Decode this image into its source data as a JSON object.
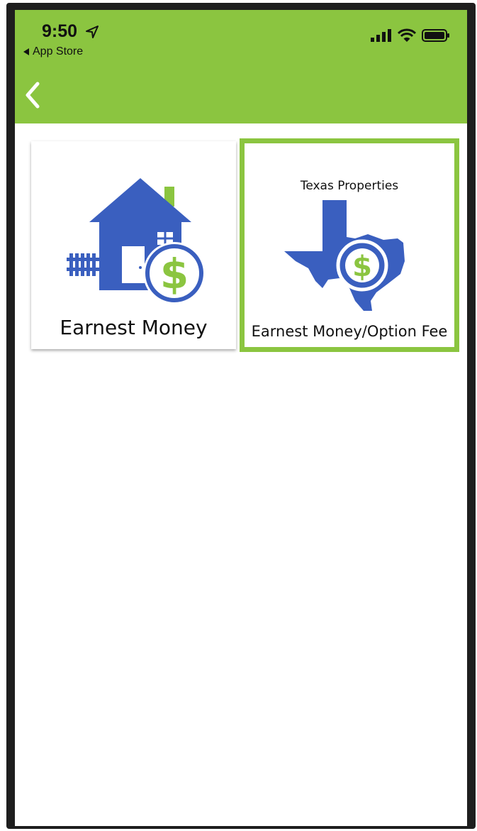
{
  "status_bar": {
    "time": "9:50",
    "back_to_app": "App Store"
  },
  "colors": {
    "header": "#8bc540",
    "icon_blue": "#3a5fbf",
    "icon_green": "#8bc540"
  },
  "icons": {
    "nav_back": "chevron-left-icon",
    "house": "house-icon",
    "texas": "texas-map-icon",
    "dollar": "dollar-coin-icon"
  },
  "tiles": [
    {
      "label": "Earnest Money"
    },
    {
      "caption": "Texas Properties",
      "label": "Earnest Money/Option Fee",
      "selected": true
    }
  ]
}
